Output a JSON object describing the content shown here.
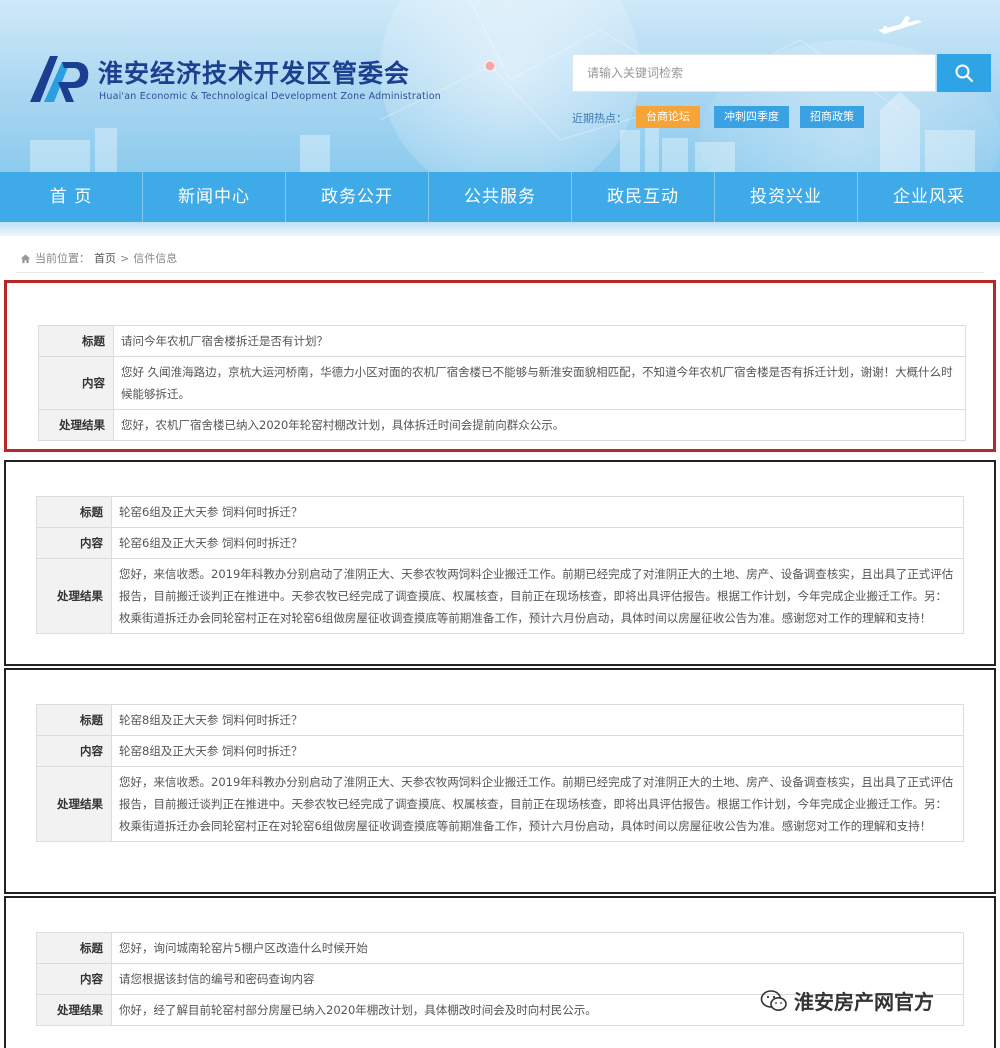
{
  "header": {
    "site_title": "淮安经济技术开发区管委会",
    "site_subtitle": "Huai'an Economic & Technological Development Zone Administration",
    "search_placeholder": "请输入关键词检索",
    "hot_label": "近期热点：",
    "hot_tags": [
      "台商论坛",
      "冲刺四季度",
      "招商政策"
    ]
  },
  "nav": {
    "items": [
      "首 页",
      "新闻中心",
      "政务公开",
      "公共服务",
      "政民互动",
      "投资兴业",
      "企业风采"
    ]
  },
  "breadcrumb": {
    "prefix": "当前位置：",
    "home": "首页",
    "separator": ">",
    "current": "信件信息"
  },
  "letters": [
    {
      "labels": [
        "标题",
        "内容",
        "处理结果"
      ],
      "title": "请问今年农机厂宿舍楼拆迁是否有计划？",
      "content": "您好 久闻淮海路边，京杭大运河桥南，华德力小区对面的农机厂宿舍楼已不能够与新淮安面貌相匹配，不知道今年农机厂宿舍楼是否有拆迁计划，谢谢！大概什么时候能够拆迁。",
      "result": "您好，农机厂宿舍楼已纳入2020年轮窑村棚改计划，具体拆迁时间会提前向群众公示。"
    },
    {
      "labels": [
        "标题",
        "内容",
        "处理结果"
      ],
      "title": "轮窑6组及正大天参 饲料何时拆迁？",
      "content": "轮窑6组及正大天参 饲料何时拆迁？",
      "result": "您好，来信收悉。2019年科教办分别启动了淮阴正大、天参农牧两饲料企业搬迁工作。前期已经完成了对淮阴正大的土地、房产、设备调查核实，且出具了正式评估报告，目前搬迁谈判正在推进中。天参农牧已经完成了调查摸底、权属核查，目前正在现场核查，即将出具评估报告。根据工作计划，今年完成企业搬迁工作。另：枚乘街道拆迁办会同轮窑村正在对轮窑6组做房屋征收调查摸底等前期准备工作，预计六月份启动，具体时间以房屋征收公告为准。感谢您对工作的理解和支持！"
    },
    {
      "labels": [
        "标题",
        "内容",
        "处理结果"
      ],
      "title": "轮窑8组及正大天参 饲料何时拆迁？",
      "content": "轮窑8组及正大天参 饲料何时拆迁？",
      "result": "您好，来信收悉。2019年科教办分别启动了淮阴正大、天参农牧两饲料企业搬迁工作。前期已经完成了对淮阴正大的土地、房产、设备调查核实，且出具了正式评估报告，目前搬迁谈判正在推进中。天参农牧已经完成了调查摸底、权属核查，目前正在现场核查，即将出具评估报告。根据工作计划，今年完成企业搬迁工作。另：枚乘街道拆迁办会同轮窑村正在对轮窑6组做房屋征收调查摸底等前期准备工作，预计六月份启动，具体时间以房屋征收公告为准。感谢您对工作的理解和支持！"
    },
    {
      "labels": [
        "标题",
        "内容",
        "处理结果"
      ],
      "title": "您好，询问城南轮窑片5棚户区改造什么时候开始",
      "content": "请您根据该封信的编号和密码查询内容",
      "result": "你好，经了解目前轮窑村部分房屋已纳入2020年棚改计划，具体棚改时间会及时向村民公示。"
    }
  ],
  "watermark": {
    "text": "淮安房产网官方",
    "icon": "wechat-icon"
  },
  "colors": {
    "nav": "#3eaae8",
    "highlight_border": "#b5282a",
    "hot_tag_primary": "#f6a437",
    "hot_tag_secondary": "#3aa2e3"
  }
}
